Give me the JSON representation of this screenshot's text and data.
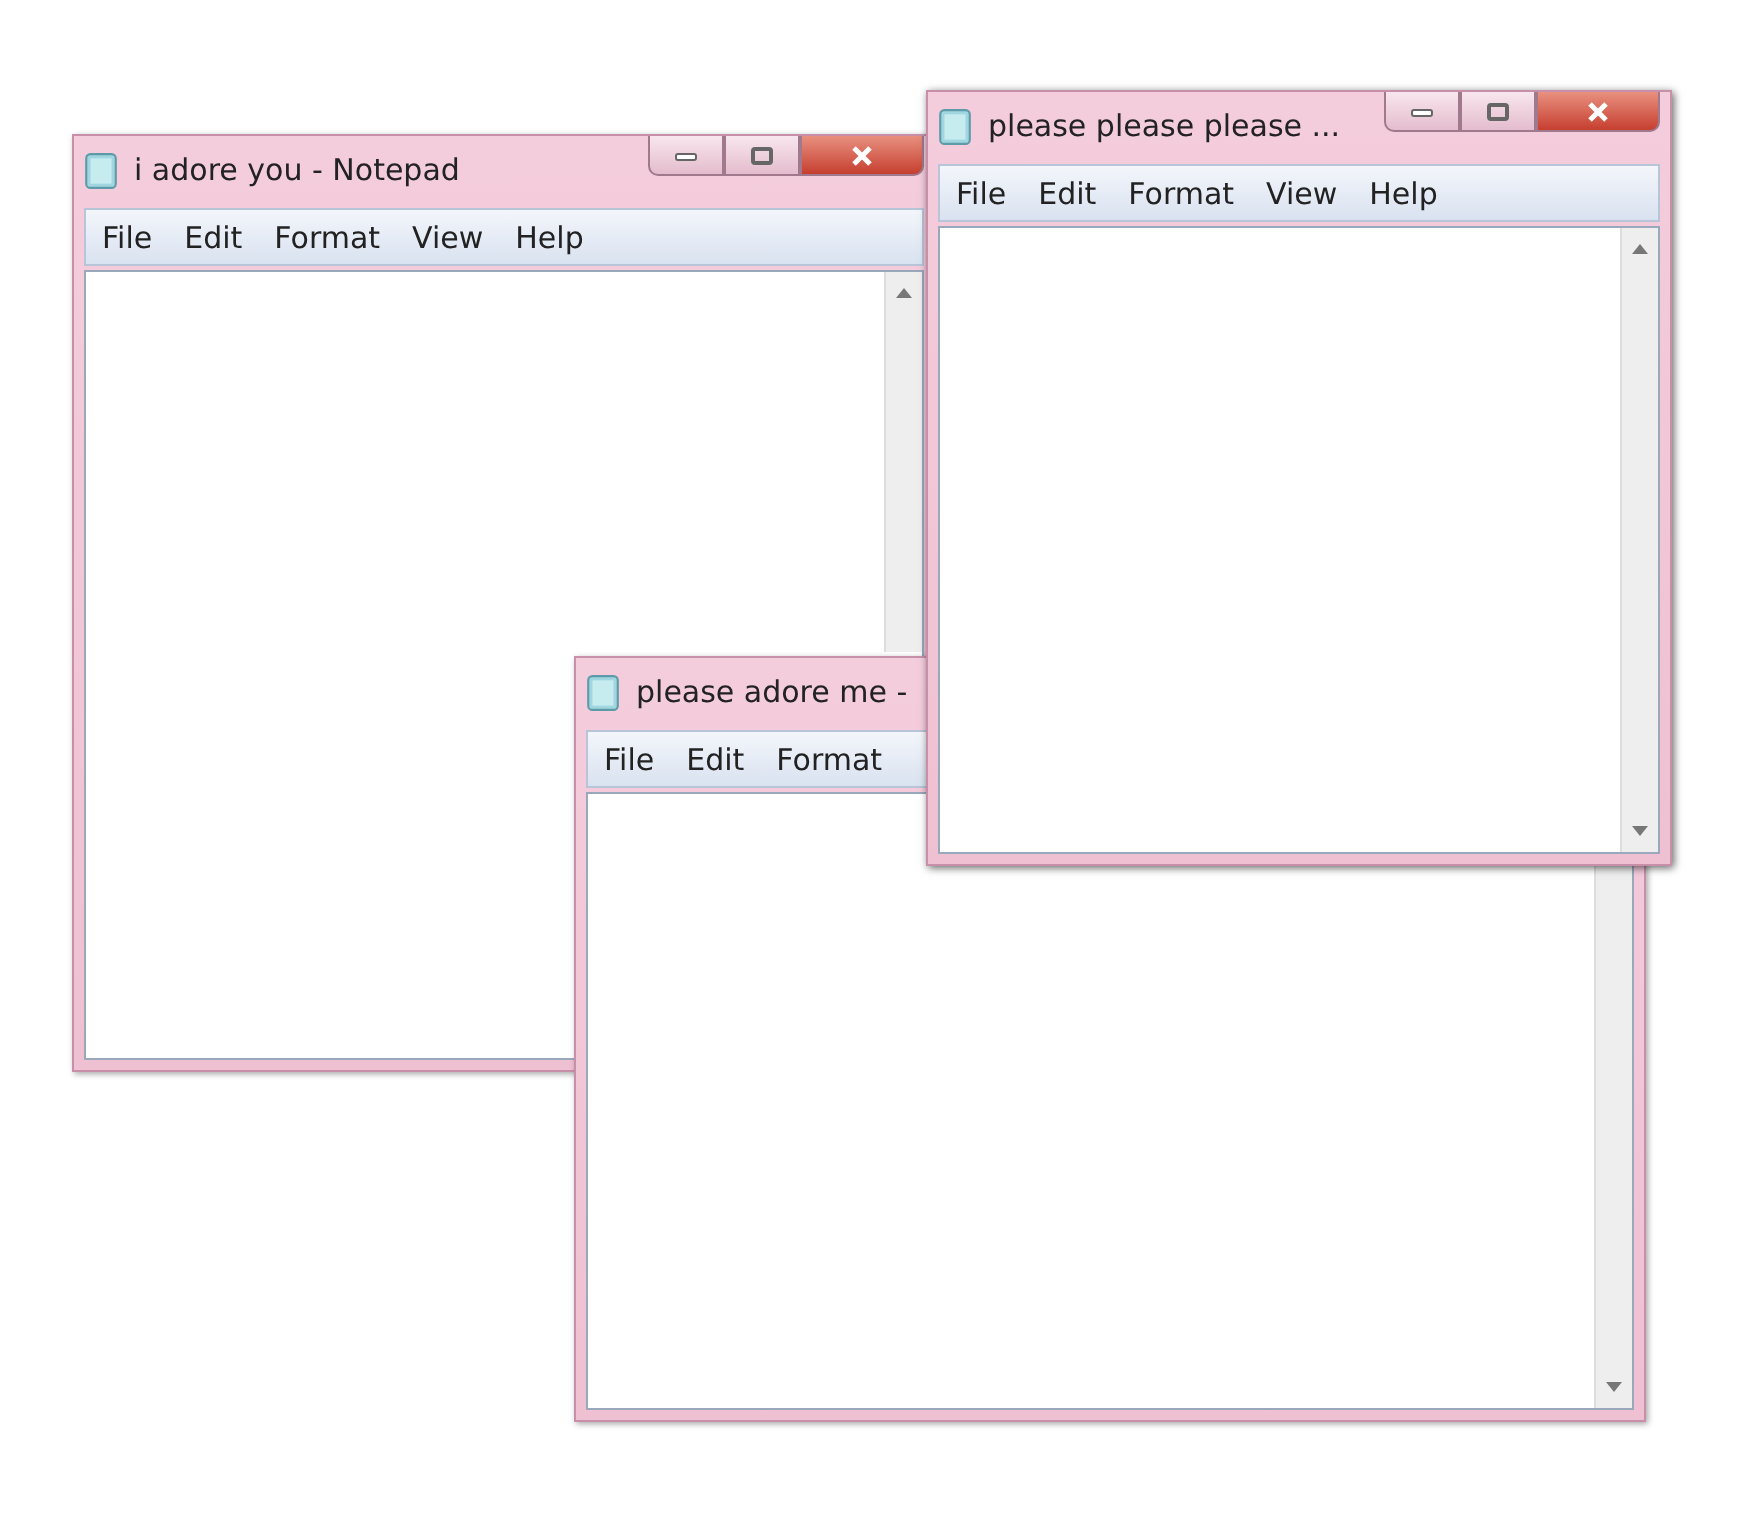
{
  "windows": [
    {
      "title": "i adore you - Notepad",
      "menu": [
        "File",
        "Edit",
        "Format",
        "View",
        "Help"
      ]
    },
    {
      "title": "please adore me -",
      "menu": [
        "File",
        "Edit",
        "Format"
      ]
    },
    {
      "title": "please please please ...",
      "menu": [
        "File",
        "Edit",
        "Format",
        "View",
        "Help"
      ]
    }
  ]
}
